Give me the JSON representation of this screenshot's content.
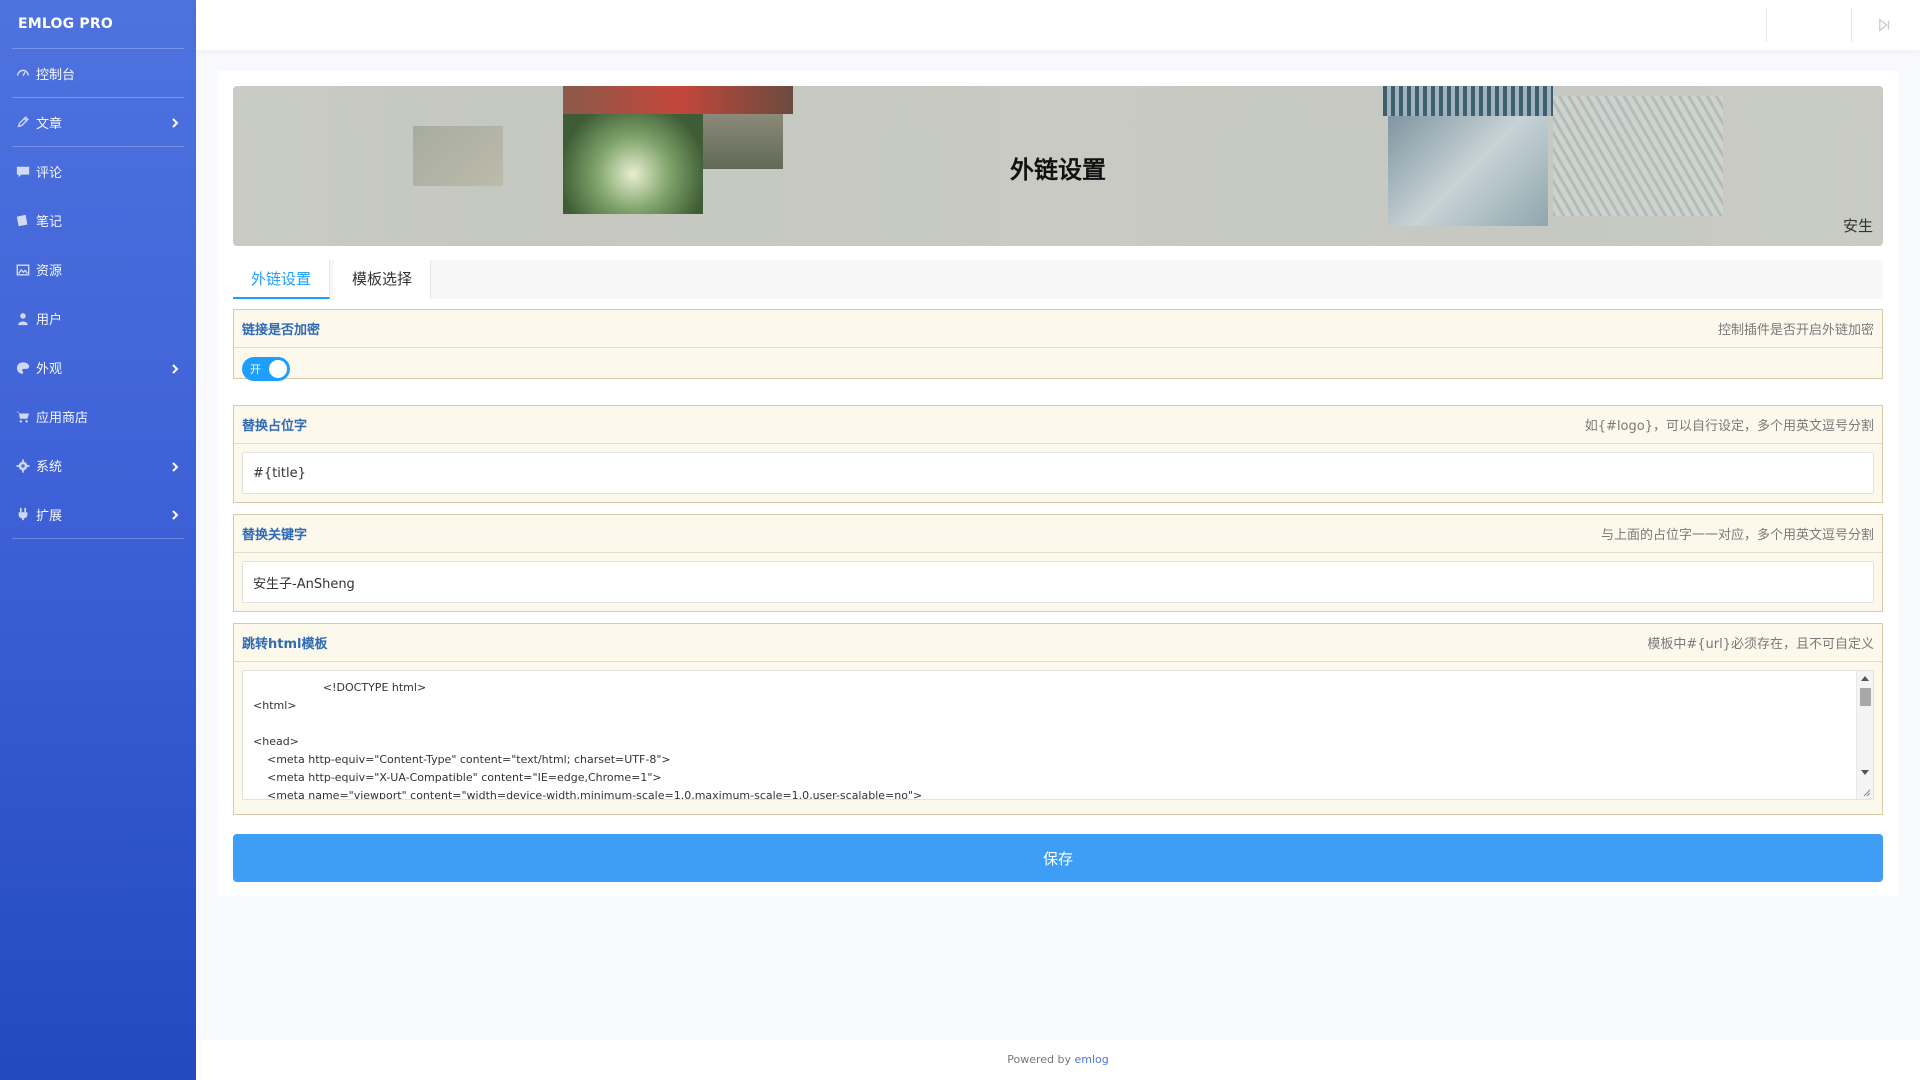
{
  "sidebar": {
    "brand": "EMLOG PRO",
    "items": [
      {
        "label": "控制台",
        "icon": "dashboard-icon",
        "has_submenu": false
      },
      {
        "label": "文章",
        "icon": "pencil-icon",
        "has_submenu": true
      },
      {
        "label": "评论",
        "icon": "comment-icon",
        "has_submenu": false
      },
      {
        "label": "笔记",
        "icon": "note-icon",
        "has_submenu": false
      },
      {
        "label": "资源",
        "icon": "image-icon",
        "has_submenu": false
      },
      {
        "label": "用户",
        "icon": "user-icon",
        "has_submenu": false
      },
      {
        "label": "外观",
        "icon": "palette-icon",
        "has_submenu": true
      },
      {
        "label": "应用商店",
        "icon": "cart-icon",
        "has_submenu": false
      },
      {
        "label": "系统",
        "icon": "gear-icon",
        "has_submenu": true
      },
      {
        "label": "扩展",
        "icon": "plug-icon",
        "has_submenu": true
      }
    ]
  },
  "topbar": {
    "logout_icon": "logout-icon"
  },
  "banner": {
    "title": "外链设置",
    "author": "安生"
  },
  "tabs": [
    {
      "label": "外链设置",
      "active": true
    },
    {
      "label": "模板选择",
      "active": false
    }
  ],
  "fields": {
    "encrypt": {
      "label": "链接是否加密",
      "hint": "控制插件是否开启外链加密",
      "switch_text": "开",
      "enabled": true
    },
    "placeholder": {
      "label": "替换占位字",
      "hint": "如{#logo}，可以自行设定，多个用英文逗号分割",
      "value": "#{title}"
    },
    "keyword": {
      "label": "替换关键字",
      "hint": "与上面的占位字一一对应，多个用英文逗号分割",
      "value": "安生子-AnSheng"
    },
    "template": {
      "label": "跳转html模板",
      "hint": "模板中#{url}必须存在，且不可自定义",
      "value": "                    <!DOCTYPE html>\n<html>\n\n<head>\n    <meta http-equiv=\"Content-Type\" content=\"text/html; charset=UTF-8\">\n    <meta http-equiv=\"X-UA-Compatible\" content=\"IE=edge,Chrome=1\">\n    <meta name=\"viewport\" content=\"width=device-width,minimum-scale=1.0,maximum-scale=1.0,user-scalable=no\">"
    }
  },
  "save_label": "保存",
  "footer": {
    "prefix": "Powered by ",
    "link": "emlog"
  },
  "colors": {
    "sidebar_top": "#4e73df",
    "sidebar_bottom": "#224abe",
    "accent": "#1e9fff",
    "save_button": "#3e9ef5",
    "field_bg": "#fdf8ec"
  }
}
